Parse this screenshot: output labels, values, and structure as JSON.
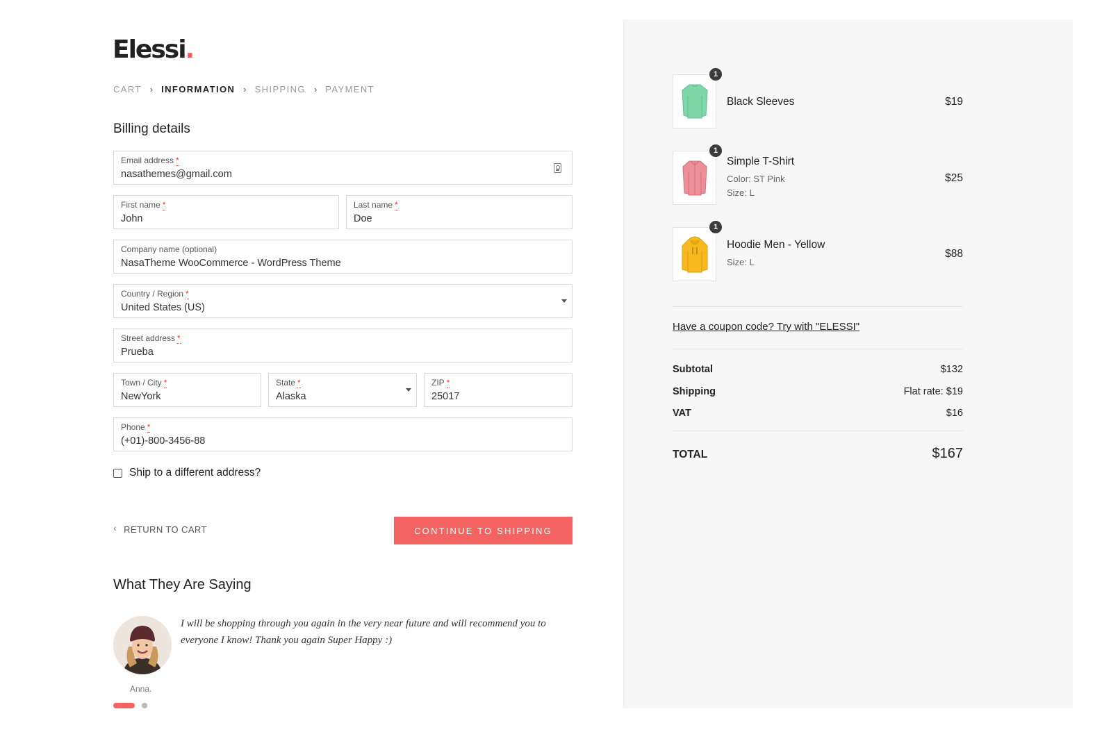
{
  "brand": {
    "name": "Elessi",
    "dot": ".",
    "accent_color": "#f26361"
  },
  "breadcrumb": [
    {
      "label": "CART",
      "active": false
    },
    {
      "label": "INFORMATION",
      "active": true
    },
    {
      "label": "SHIPPING",
      "active": false
    },
    {
      "label": "PAYMENT",
      "active": false
    }
  ],
  "billing": {
    "title": "Billing details",
    "required_mark": "*",
    "email": {
      "label": "Email address",
      "value": "nasathemes@gmail.com",
      "icon": "contact-card-icon"
    },
    "first_name": {
      "label": "First name",
      "value": "John"
    },
    "last_name": {
      "label": "Last name",
      "value": "Doe"
    },
    "company": {
      "label": "Company name (optional)",
      "value": "NasaTheme WooCommerce - WordPress Theme"
    },
    "country": {
      "label": "Country / Region",
      "value": "United States (US)"
    },
    "street": {
      "label": "Street address",
      "value": "Prueba"
    },
    "city": {
      "label": "Town / City",
      "value": "NewYork"
    },
    "state": {
      "label": "State",
      "value": "Alaska"
    },
    "zip": {
      "label": "ZIP",
      "value": "25017"
    },
    "phone": {
      "label": "Phone",
      "value": "(+01)-800-3456-88"
    },
    "ship_different": {
      "label": "Ship to a different address?",
      "checked": false
    }
  },
  "actions": {
    "return_label": "RETURN TO CART",
    "continue_label": "CONTINUE TO SHIPPING"
  },
  "testimonials": {
    "title": "What They Are Saying",
    "quote": "I will be shopping through you again in the very near future and will recommend you to everyone I know! Thank you again Super Happy :)",
    "author": "Anna.",
    "slide_count": 2,
    "active_slide": 1
  },
  "cart": {
    "items": [
      {
        "name": "Black Sleeves",
        "qty": "1",
        "price": "$19",
        "meta": [],
        "image_color": "#7fd6a8"
      },
      {
        "name": "Simple T-Shirt",
        "qty": "1",
        "price": "$25",
        "meta": [
          "Color: ST Pink",
          "Size: L"
        ],
        "image_color": "#ec8f98"
      },
      {
        "name": "Hoodie Men - Yellow",
        "qty": "1",
        "price": "$88",
        "meta": [
          "Size: L"
        ],
        "image_color": "#f7b91f"
      }
    ],
    "coupon_text": "Have a coupon code? Try with \"ELESSI\"",
    "subtotal": {
      "label": "Subtotal",
      "value": "$132"
    },
    "shipping": {
      "label": "Shipping",
      "value": "Flat rate: $19"
    },
    "vat": {
      "label": "VAT",
      "value": "$16"
    },
    "total": {
      "label": "TOTAL",
      "value": "$167"
    }
  }
}
